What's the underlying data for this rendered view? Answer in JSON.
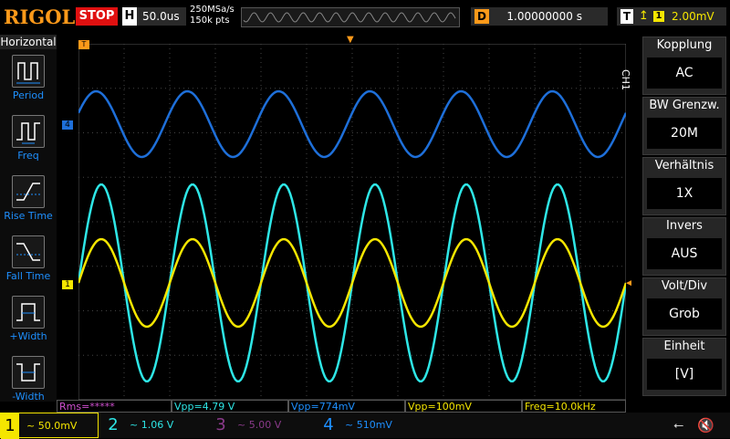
{
  "header": {
    "logo": "RIGOL",
    "run_state": "STOP",
    "timebase_letter": "H",
    "timebase": "50.0us",
    "sample_rate": "250MSa/s",
    "memory_depth": "150k pts",
    "delay_letter": "D",
    "delay": "1.00000000 s",
    "trigger_letter": "T",
    "trigger_source": "1",
    "trigger_level": "2.00mV"
  },
  "left_menu": {
    "title": "Horizontal",
    "items": [
      {
        "label": "Period",
        "icon": "period-icon"
      },
      {
        "label": "Freq",
        "icon": "freq-icon"
      },
      {
        "label": "Rise Time",
        "icon": "rise-time-icon"
      },
      {
        "label": "Fall Time",
        "icon": "fall-time-icon"
      },
      {
        "label": "+Width",
        "icon": "pos-width-icon"
      },
      {
        "label": "-Width",
        "icon": "neg-width-icon"
      }
    ]
  },
  "right_menu": {
    "channel_tag": "CH1",
    "items": [
      {
        "name": "Kopplung",
        "value": "AC"
      },
      {
        "name": "BW Grenzw.",
        "value": "20M"
      },
      {
        "name": "Verhältnis",
        "value": "1X"
      },
      {
        "name": "Invers",
        "value": "AUS"
      },
      {
        "name": "Volt/Div",
        "value": "Grob"
      },
      {
        "name": "Einheit",
        "value": "[V]"
      }
    ]
  },
  "waveforms": {
    "ch4": {
      "color": "#1e6fd9",
      "marker": "4"
    },
    "ch2": {
      "color": "#2ee6e6"
    },
    "ch1": {
      "color": "#f5e600",
      "marker": "1"
    }
  },
  "trigger_markers": {
    "top": "T"
  },
  "measurements": [
    {
      "text": "Rms=*****",
      "color": "#d050d0"
    },
    {
      "text": "Vpp=4.79 V",
      "color": "#2ee6e6"
    },
    {
      "text": "Vpp=774mV",
      "color": "#1e90ff"
    },
    {
      "text": "Vpp=100mV",
      "color": "#f5e600"
    },
    {
      "text": "Freq=10.0kHz",
      "color": "#f5e600"
    }
  ],
  "channels": [
    {
      "num": "1",
      "value": "~ 50.0mV",
      "color": "#f5e600",
      "active": true
    },
    {
      "num": "2",
      "value": "~ 1.06 V",
      "color": "#2ee6e6",
      "active": false
    },
    {
      "num": "3",
      "value": "~ 5.00 V",
      "color": "#8a3a8a",
      "active": false
    },
    {
      "num": "4",
      "value": "~ 510mV",
      "color": "#1e90ff",
      "active": false
    }
  ],
  "status_icons": [
    "usb-icon",
    "speaker-muted-icon"
  ]
}
